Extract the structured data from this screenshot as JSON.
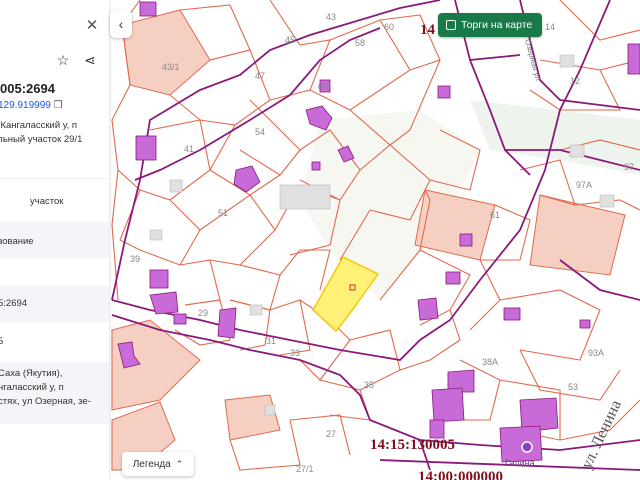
{
  "panel": {
    "cadastral_number": "005:2694",
    "area_link": "129.919999",
    "address_line1": "а-Кангаласский у, п",
    "address_line2": "ильный участок 29/1",
    "type_label": "участок",
    "usage_label": "зование",
    "number_short": "5:2694",
    "digit": "5",
    "region_line1": "Саха (Якутия),",
    "region_line2": "нгаласский у, п",
    "region_line3": "стях, ул Озерная, зе-",
    "close_icon": "close-icon",
    "star_icon": "star-icon",
    "share_icon": "share-icon",
    "copy_icon": "copy-icon"
  },
  "map": {
    "collapse_icon": "chevron-left-icon",
    "auction_button": "Торги на карте",
    "legend_button": "Легенда",
    "quarter_labels": {
      "top": "14",
      "q1": "14:15:130005",
      "q2": "14:00:000000"
    },
    "street_label": "ул. Ленина",
    "street_top": "Озерная ул",
    "poi_label": "Галина",
    "house_numbers": [
      "43/1",
      "45",
      "47",
      "43",
      "58",
      "60",
      "60",
      "54",
      "41",
      "51",
      "39",
      "29",
      "31",
      "33",
      "35",
      "27",
      "27/1",
      "61",
      "97",
      "97А",
      "38А",
      "93А",
      "53",
      "12",
      "14"
    ],
    "colors": {
      "parcel_line": "#e06a4e",
      "quarter_line": "#8a1a7a",
      "building": "#c86ad8",
      "selected_parcel": "#fff176",
      "auction_green": "#1a7a47"
    }
  }
}
